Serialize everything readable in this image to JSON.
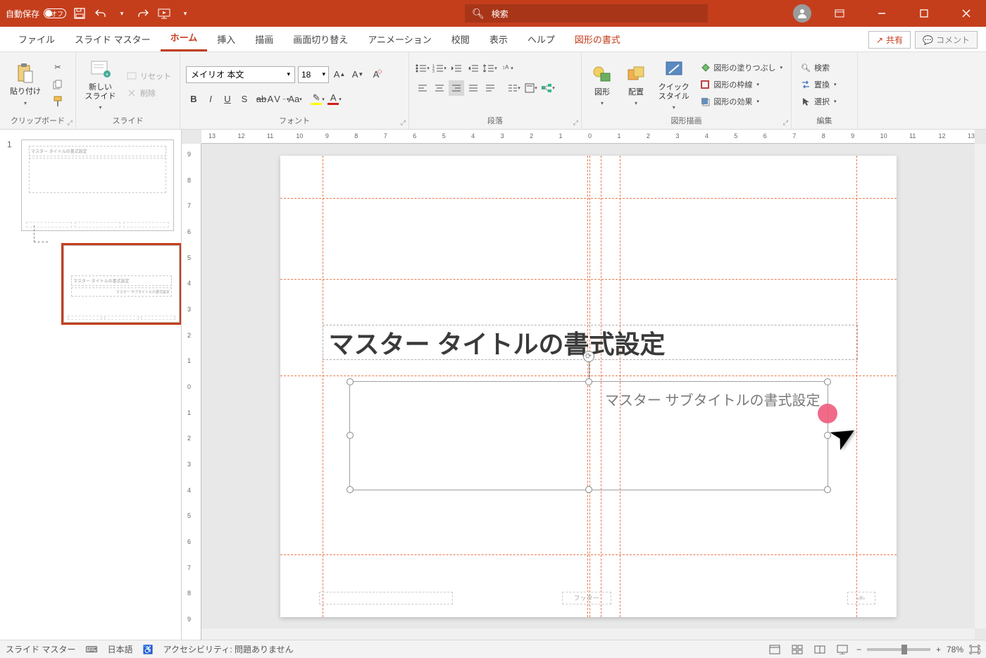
{
  "titlebar": {
    "autosave_label": "自動保存",
    "autosave_state": "オフ",
    "search_placeholder": "検索"
  },
  "tabs": {
    "file": "ファイル",
    "slide_master": "スライド マスター",
    "home": "ホーム",
    "insert": "挿入",
    "draw": "描画",
    "transitions": "画面切り替え",
    "animations": "アニメーション",
    "review": "校閲",
    "view": "表示",
    "help": "ヘルプ",
    "shape_format": "図形の書式",
    "share": "共有",
    "comments": "コメント"
  },
  "ribbon": {
    "clipboard": {
      "paste": "貼り付け",
      "label": "クリップボード"
    },
    "slides": {
      "new_slide": "新しい\nスライド",
      "reset": "リセット",
      "delete": "削除",
      "label": "スライド"
    },
    "font": {
      "name": "メイリオ 本文",
      "size": "18",
      "label": "フォント"
    },
    "paragraph": {
      "label": "段落"
    },
    "drawing": {
      "shapes": "図形",
      "arrange": "配置",
      "quick_styles": "クイック\nスタイル",
      "fill": "図形の塗りつぶし",
      "outline": "図形の枠線",
      "effects": "図形の効果",
      "label": "図形描画"
    },
    "editing": {
      "find": "検索",
      "replace": "置換",
      "select": "選択",
      "label": "編集"
    }
  },
  "slide": {
    "title_text": "マスター タイトルの書式設定",
    "subtitle_text": "マスター サブタイトルの書式設定",
    "footer_center": "フッター",
    "footer_num": "‹#›",
    "thumb1_text": "マスター タイトルの書式設定",
    "thumb2_title": "マスター タイトルの書式設定",
    "thumb2_sub": "マスター サブタイトルの書式設定"
  },
  "thumbnails": {
    "num1": "1"
  },
  "ruler": {
    "h": [
      "13",
      "12",
      "11",
      "10",
      "9",
      "8",
      "7",
      "6",
      "5",
      "4",
      "3",
      "2",
      "1",
      "0",
      "1",
      "2",
      "3",
      "4",
      "5",
      "6",
      "7",
      "8",
      "9",
      "10",
      "11",
      "12",
      "13"
    ],
    "v": [
      "9",
      "8",
      "7",
      "6",
      "5",
      "4",
      "3",
      "2",
      "1",
      "0",
      "1",
      "2",
      "3",
      "4",
      "5",
      "6",
      "7",
      "8",
      "9"
    ]
  },
  "statusbar": {
    "mode": "スライド マスター",
    "language": "日本語",
    "accessibility": "アクセシビリティ: 問題ありません",
    "zoom": "78%"
  },
  "colors": {
    "accent": "#c43e1c"
  }
}
